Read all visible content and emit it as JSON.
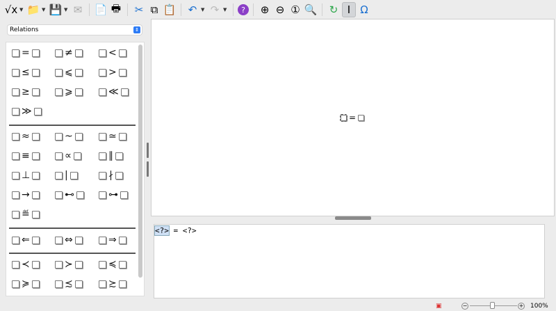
{
  "toolbar": {
    "items": [
      {
        "name": "new-formula-icon",
        "glyph": "√x"
      },
      {
        "name": "open-icon",
        "glyph": "📁"
      },
      {
        "name": "save-icon",
        "glyph": "💾"
      },
      {
        "name": "email-icon",
        "glyph": "✉"
      },
      {
        "name": "export-pdf-icon",
        "glyph": "📄"
      },
      {
        "name": "print-icon",
        "glyph": "🖶"
      },
      {
        "name": "cut-icon",
        "glyph": "✂"
      },
      {
        "name": "copy-icon",
        "glyph": "⧉"
      },
      {
        "name": "paste-icon",
        "glyph": "📋"
      },
      {
        "name": "undo-icon",
        "glyph": "↶"
      },
      {
        "name": "redo-icon",
        "glyph": "↷"
      },
      {
        "name": "help-icon",
        "glyph": "?"
      },
      {
        "name": "zoom-in-icon",
        "glyph": "⊕"
      },
      {
        "name": "zoom-out-icon",
        "glyph": "⊖"
      },
      {
        "name": "zoom-100-icon",
        "glyph": "①"
      },
      {
        "name": "show-all-icon",
        "glyph": "🔍"
      },
      {
        "name": "update-icon",
        "glyph": "↻"
      },
      {
        "name": "formula-cursor-icon",
        "glyph": "I"
      },
      {
        "name": "symbols-icon",
        "glyph": "Ω"
      }
    ]
  },
  "sidebar": {
    "category": "Relations",
    "groups": [
      [
        [
          "=",
          "≠",
          "<"
        ],
        [
          "≤",
          "⩽",
          ">"
        ],
        [
          "≥",
          "⩾",
          "≪"
        ],
        [
          "≫"
        ]
      ],
      [
        [
          "≈",
          "~",
          "≃"
        ],
        [
          "≡",
          "∝",
          "∥"
        ],
        [
          "⊥",
          "|",
          "∤"
        ],
        [
          "→",
          "⊷",
          "⊶"
        ],
        [
          "≝"
        ]
      ],
      [
        [
          "⇐",
          "⇔",
          "⇒"
        ]
      ],
      [
        [
          "≺",
          "≻",
          "≼"
        ],
        [
          "≽",
          "≾",
          "≿"
        ]
      ]
    ]
  },
  "formula": {
    "operator": "="
  },
  "editor": {
    "placeholder_left": "<?>",
    "text": " = <?>"
  },
  "status": {
    "zoom": "100%",
    "zoom_out": "−",
    "zoom_in": "+"
  }
}
